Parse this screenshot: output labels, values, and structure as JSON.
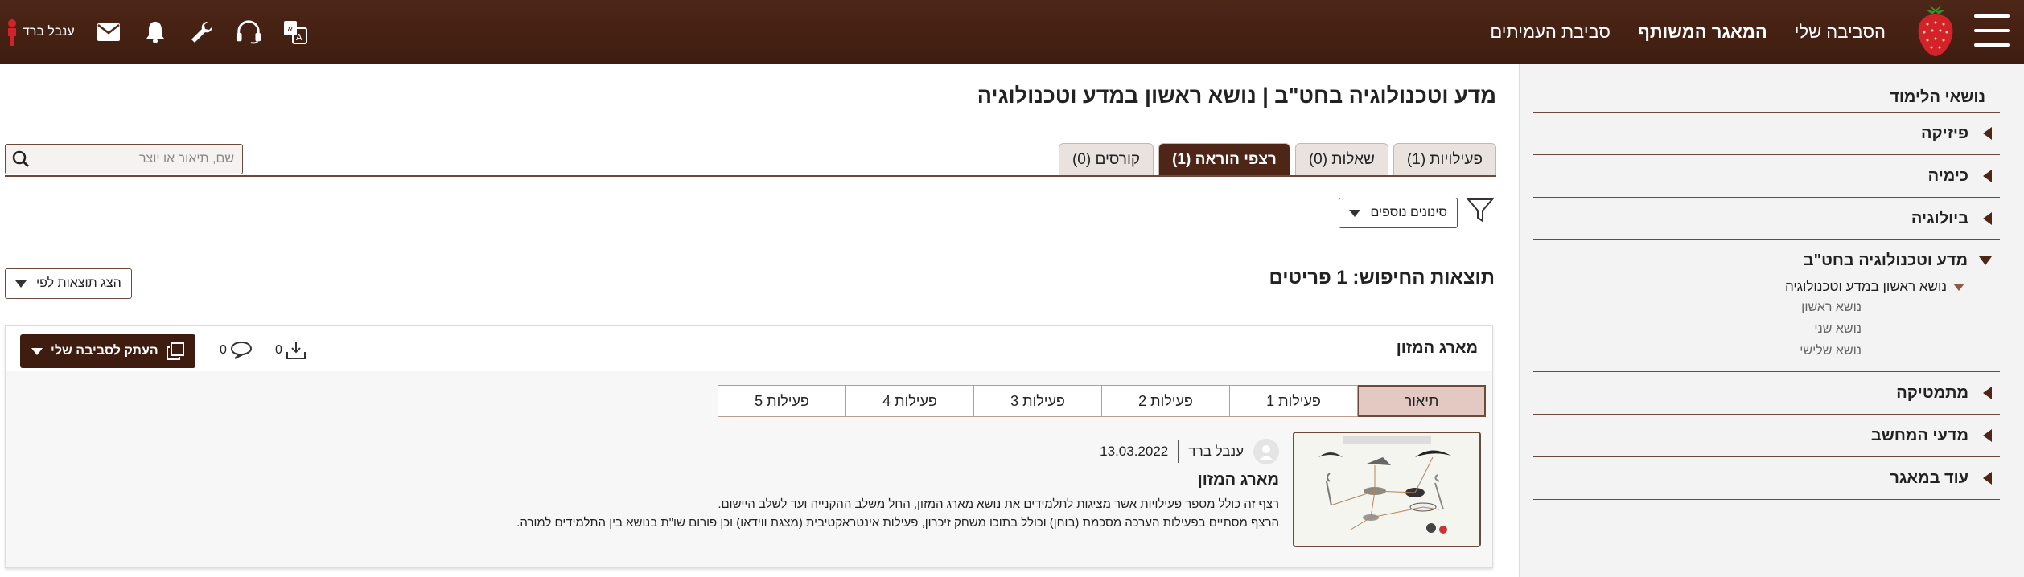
{
  "header": {
    "nav": [
      "הסביבה שלי",
      "המאגר המשותף",
      "סביבת העמיתים"
    ],
    "user_name": "ענבל ברד",
    "icons": [
      "menu-icon",
      "strawberry-logo",
      "translate-icon",
      "headset-icon",
      "wrench-icon",
      "bell-icon",
      "mail-icon",
      "user-icon"
    ],
    "colors": {
      "bar": "#4d2617",
      "accent": "#6b4a3a"
    }
  },
  "sidebar": {
    "title": "נושאי הלימוד",
    "items_before": [
      "פיזיקה",
      "כימיה",
      "ביולוגיה"
    ],
    "open_item": {
      "label": "מדע וטכנולוגיה בחט\"ב",
      "sub_label": "נושא ראשון במדע וטכנולוגיה",
      "leaves": [
        "נושא ראשון",
        "נושא שני",
        "נושא שלישי"
      ]
    },
    "items_after": [
      "מתמטיקה",
      "מדעי המחשב",
      "עוד במאגר"
    ]
  },
  "main": {
    "title": "מדע וטכנולוגיה בחט\"ב | נושא ראשון במדע וטכנולוגיה",
    "tabs": [
      {
        "label": "פעילויות (1)",
        "active": false
      },
      {
        "label": "שאלות (0)",
        "active": false
      },
      {
        "label": "רצפי הוראה (1)",
        "active": true
      },
      {
        "label": "קורסים (0)",
        "active": false
      }
    ],
    "search_placeholder": "שם, תיאור או יוצר",
    "more_filters": "סינונים נוספים",
    "results_title": "תוצאות החיפוש: 1 פריטים",
    "sort_label": "הצג תוצאות לפי"
  },
  "card": {
    "title": "מארג המזון",
    "copy_label": "העתק לסביבה שלי",
    "downloads": "0",
    "comments": "0",
    "tabs": [
      "תיאור",
      "פעילות 1",
      "פעילות 2",
      "פעילות 3",
      "פעילות 4",
      "פעילות 5"
    ],
    "author": "ענבל ברד",
    "date": "13.03.2022",
    "activity_name": "מארג המזון",
    "description": [
      "רצף זה כולל מספר פעילויות אשר מציגות לתלמידים את נושא מארג המזון, החל משלב ההקנייה ועד לשלב היישום.",
      "הרצף מסתיים בפעילות הערכה מסכמת (בוחן) וכולל בתוכו משחק זיכרון, פעילות אינטראקטיבית (מצגת ווידאו) וכן פורום שו\"ת בנושא בין התלמידים למורה."
    ]
  }
}
